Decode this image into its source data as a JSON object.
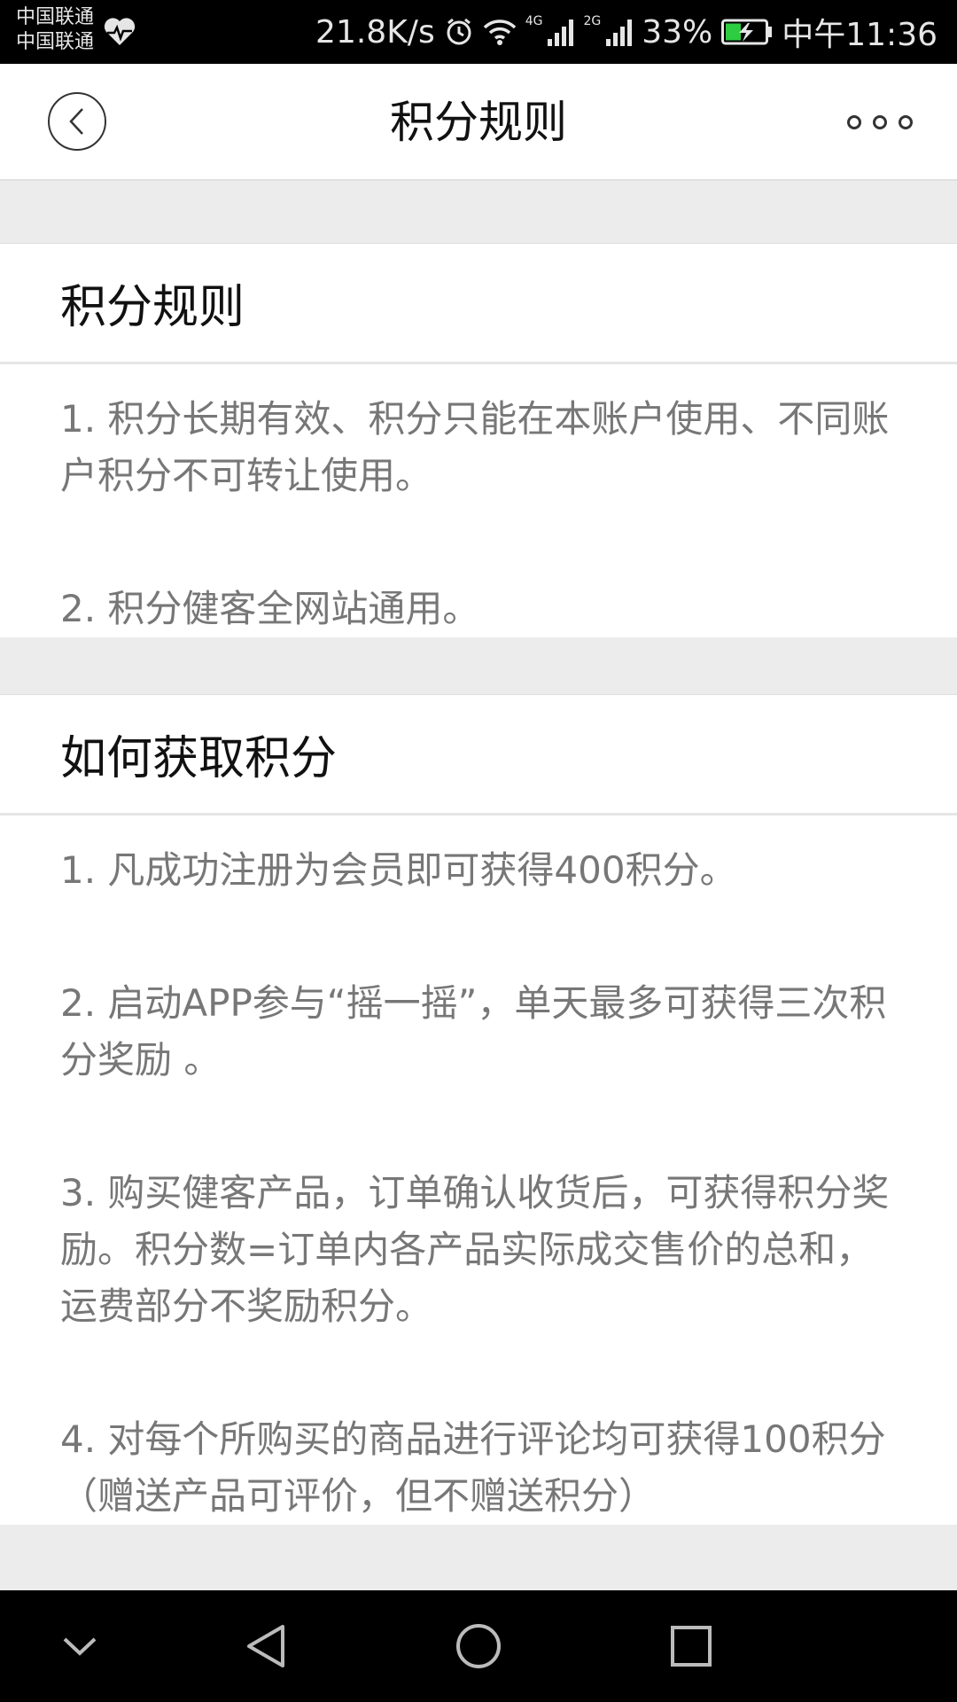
{
  "status_bar": {
    "carrier_1": "中国联通",
    "carrier_2": "中国联通",
    "net_speed": "21.8K/s",
    "signal_1_label": "4G",
    "signal_2_label": "2G",
    "battery": "33%",
    "time": "中午11:36"
  },
  "header": {
    "title": "积分规则"
  },
  "sections": [
    {
      "title": "积分规则",
      "items": [
        "1. 积分长期有效、积分只能在本账户使用、不同账户积分不可转让使用。",
        "2. 积分健客全网站通用。"
      ]
    },
    {
      "title": "如何获取积分",
      "items": [
        "1. 凡成功注册为会员即可获得400积分。",
        "2. 启动APP参与“摇一摇”，单天最多可获得三次积分奖励 。",
        "3. 购买健客产品，订单确认收货后，可获得积分奖励。积分数=订单内各产品实际成交售价的总和，运费部分不奖励积分。",
        "4. 对每个所购买的商品进行评论均可获得100积分（赠送产品可评价，但不赠送积分）"
      ]
    }
  ],
  "icons": {
    "back": "back-arrow-icon",
    "more": "more-dots-icon",
    "nav_down": "chevron-down-icon",
    "nav_back": "triangle-back-icon",
    "nav_home": "circle-home-icon",
    "nav_recent": "square-recent-icon"
  },
  "colors": {
    "battery_fill": "#2ecc40",
    "page_background": "#ececec",
    "body_text": "#777777"
  }
}
